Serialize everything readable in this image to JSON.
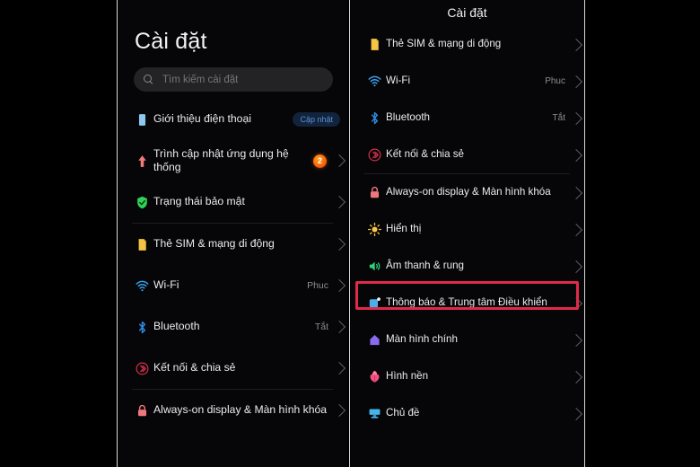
{
  "left_panel": {
    "title": "Cài đặt",
    "search": {
      "placeholder": "Tìm kiếm cài đặt",
      "icon": "search-icon"
    },
    "groups": [
      {
        "items": [
          {
            "icon": "phone-icon",
            "label": "Giới thiệu điện thoại",
            "badge_pill": "Cập nhật",
            "value": "",
            "chevron": false
          },
          {
            "icon": "system-update-arrow-icon",
            "label": "Trình cập nhật ứng dụng hệ thống",
            "badge_count": "2",
            "value": "",
            "chevron": true
          },
          {
            "icon": "security-shield-icon",
            "label": "Trạng thái bảo mật",
            "value": "",
            "chevron": true
          }
        ]
      },
      {
        "items": [
          {
            "icon": "sim-card-icon",
            "label": "Thẻ SIM & mạng di động",
            "value": "",
            "chevron": true
          },
          {
            "icon": "wifi-icon",
            "label": "Wi-Fi",
            "value": "Phuc",
            "chevron": true
          },
          {
            "icon": "bluetooth-icon",
            "label": "Bluetooth",
            "value": "Tắt",
            "chevron": true
          },
          {
            "icon": "connection-sharing-icon",
            "label": "Kết nối & chia sẻ",
            "value": "",
            "chevron": true
          }
        ]
      },
      {
        "items": [
          {
            "icon": "lock-icon",
            "label": "Always-on display & Màn hình khóa",
            "value": "",
            "chevron": true
          }
        ]
      }
    ]
  },
  "right_panel": {
    "title": "Cài đặt",
    "groups": [
      {
        "items": [
          {
            "icon": "sim-card-icon",
            "label": "Thẻ SIM & mạng di động",
            "value": "",
            "chevron": true
          },
          {
            "icon": "wifi-icon",
            "label": "Wi-Fi",
            "value": "Phuc",
            "chevron": true
          },
          {
            "icon": "bluetooth-icon",
            "label": "Bluetooth",
            "value": "Tắt",
            "chevron": true
          },
          {
            "icon": "connection-sharing-icon",
            "label": "Kết nối & chia sẻ",
            "value": "",
            "chevron": true
          }
        ]
      },
      {
        "items": [
          {
            "icon": "lock-icon",
            "label": "Always-on display & Màn hình khóa",
            "value": "",
            "chevron": true
          },
          {
            "icon": "brightness-sun-icon",
            "label": "Hiển thị",
            "value": "",
            "chevron": true
          },
          {
            "icon": "sound-speaker-icon",
            "label": "Âm thanh & rung",
            "value": "",
            "chevron": true,
            "highlighted": true
          },
          {
            "icon": "notification-icon",
            "label": "Thông báo & Trung tâm Điều khiển",
            "value": "",
            "chevron": true
          },
          {
            "icon": "home-screen-icon",
            "label": "Màn hình chính",
            "value": "",
            "chevron": true
          },
          {
            "icon": "wallpaper-flower-icon",
            "label": "Hình nền",
            "value": "",
            "chevron": true
          },
          {
            "icon": "theme-icon",
            "label": "Chủ đề",
            "value": "",
            "chevron": true
          }
        ]
      }
    ]
  },
  "colors": {
    "background": "#000000",
    "panel": "#060608",
    "highlight_border": "#e02a4a",
    "badge_orange": "#f2590a",
    "pill_bg": "#12233c",
    "pill_text": "#5c8fd6",
    "label_text": "#ececed",
    "value_text": "#8d8d92"
  }
}
